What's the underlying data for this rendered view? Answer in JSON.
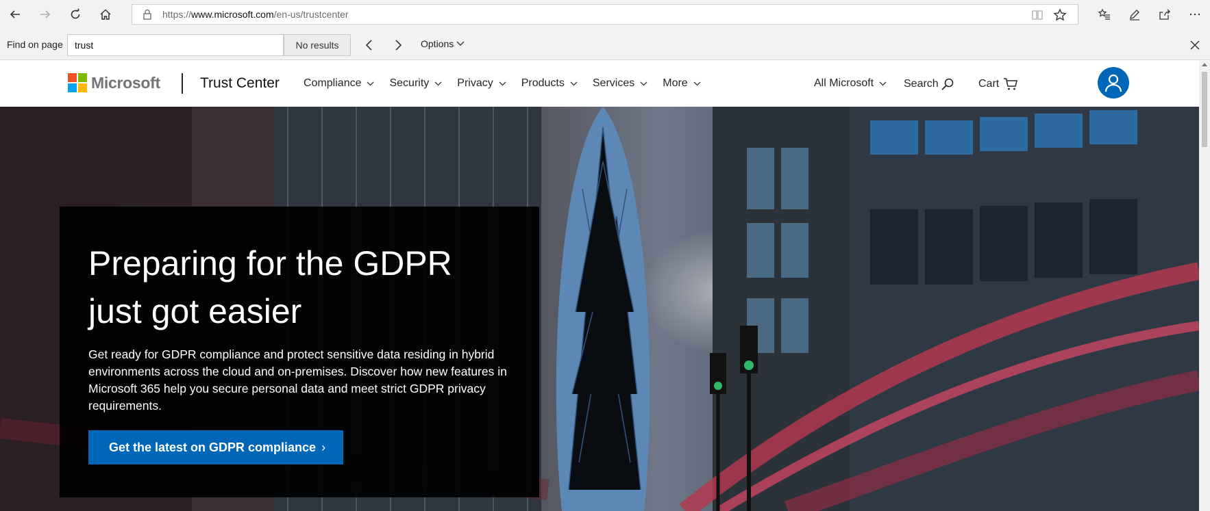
{
  "browser": {
    "url_prefix": "https://",
    "url_host": "www.microsoft.com",
    "url_path": "/en-us/trustcenter"
  },
  "find_bar": {
    "label": "Find on page",
    "query": "trust",
    "results": "No results",
    "options_label": "Options"
  },
  "header": {
    "brand": "Microsoft",
    "site_title": "Trust Center",
    "nav": [
      "Compliance",
      "Security",
      "Privacy",
      "Products",
      "Services",
      "More"
    ],
    "all_microsoft": "All Microsoft",
    "search": "Search",
    "cart": "Cart"
  },
  "hero": {
    "title": "Preparing for the GDPR just got easier",
    "description": "Get ready for GDPR compliance and protect sensitive data residing in hybrid environments across the cloud and on-premises. Discover how new features in Microsoft 365 help you secure personal data and meet strict GDPR privacy requirements.",
    "cta": "Get the latest on GDPR compliance",
    "cta_chevron": "›"
  },
  "colors": {
    "accent": "#0067b8",
    "logo_red": "#f25022",
    "logo_green": "#7fba00",
    "logo_blue": "#00a4ef",
    "logo_yellow": "#ffb900"
  },
  "icons": [
    "back-icon",
    "forward-icon",
    "refresh-icon",
    "home-icon",
    "lock-icon",
    "reading-view-icon",
    "favorite-star-icon",
    "favorites-hub-icon",
    "pen-icon",
    "share-icon",
    "more-icon",
    "chevron-left-icon",
    "chevron-right-icon",
    "close-icon",
    "search-icon",
    "cart-icon",
    "user-icon"
  ]
}
